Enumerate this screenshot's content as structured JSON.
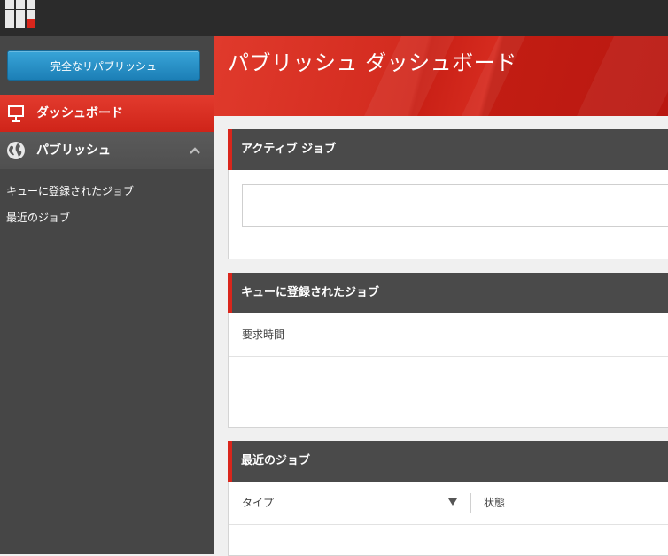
{
  "sidebar": {
    "publish_button": "完全なリパブリッシュ",
    "nav": {
      "dashboard": "ダッシュボード",
      "publish": "パブリッシュ"
    },
    "links": [
      "キューに登録されたジョブ",
      "最近のジョブ"
    ]
  },
  "header": {
    "title": "パブリッシュ ダッシュボード"
  },
  "panels": {
    "active": {
      "title": "アクティブ ジョブ"
    },
    "queued": {
      "title": "キューに登録されたジョブ",
      "columns": [
        "要求時間"
      ]
    },
    "recent": {
      "title": "最近のジョブ",
      "columns": [
        "タイプ",
        "状態"
      ]
    }
  },
  "colors": {
    "accent_red": "#d9261c",
    "button_blue": "#1c7fb6",
    "sidebar_bg": "#464646",
    "panel_header_bg": "#4a4a4a"
  },
  "icons": {
    "app_launcher": "grid-icon",
    "dashboard": "presentation-board-icon",
    "publish": "globe-icon",
    "collapse": "chevron-up-icon",
    "sort": "sort-down-icon"
  }
}
